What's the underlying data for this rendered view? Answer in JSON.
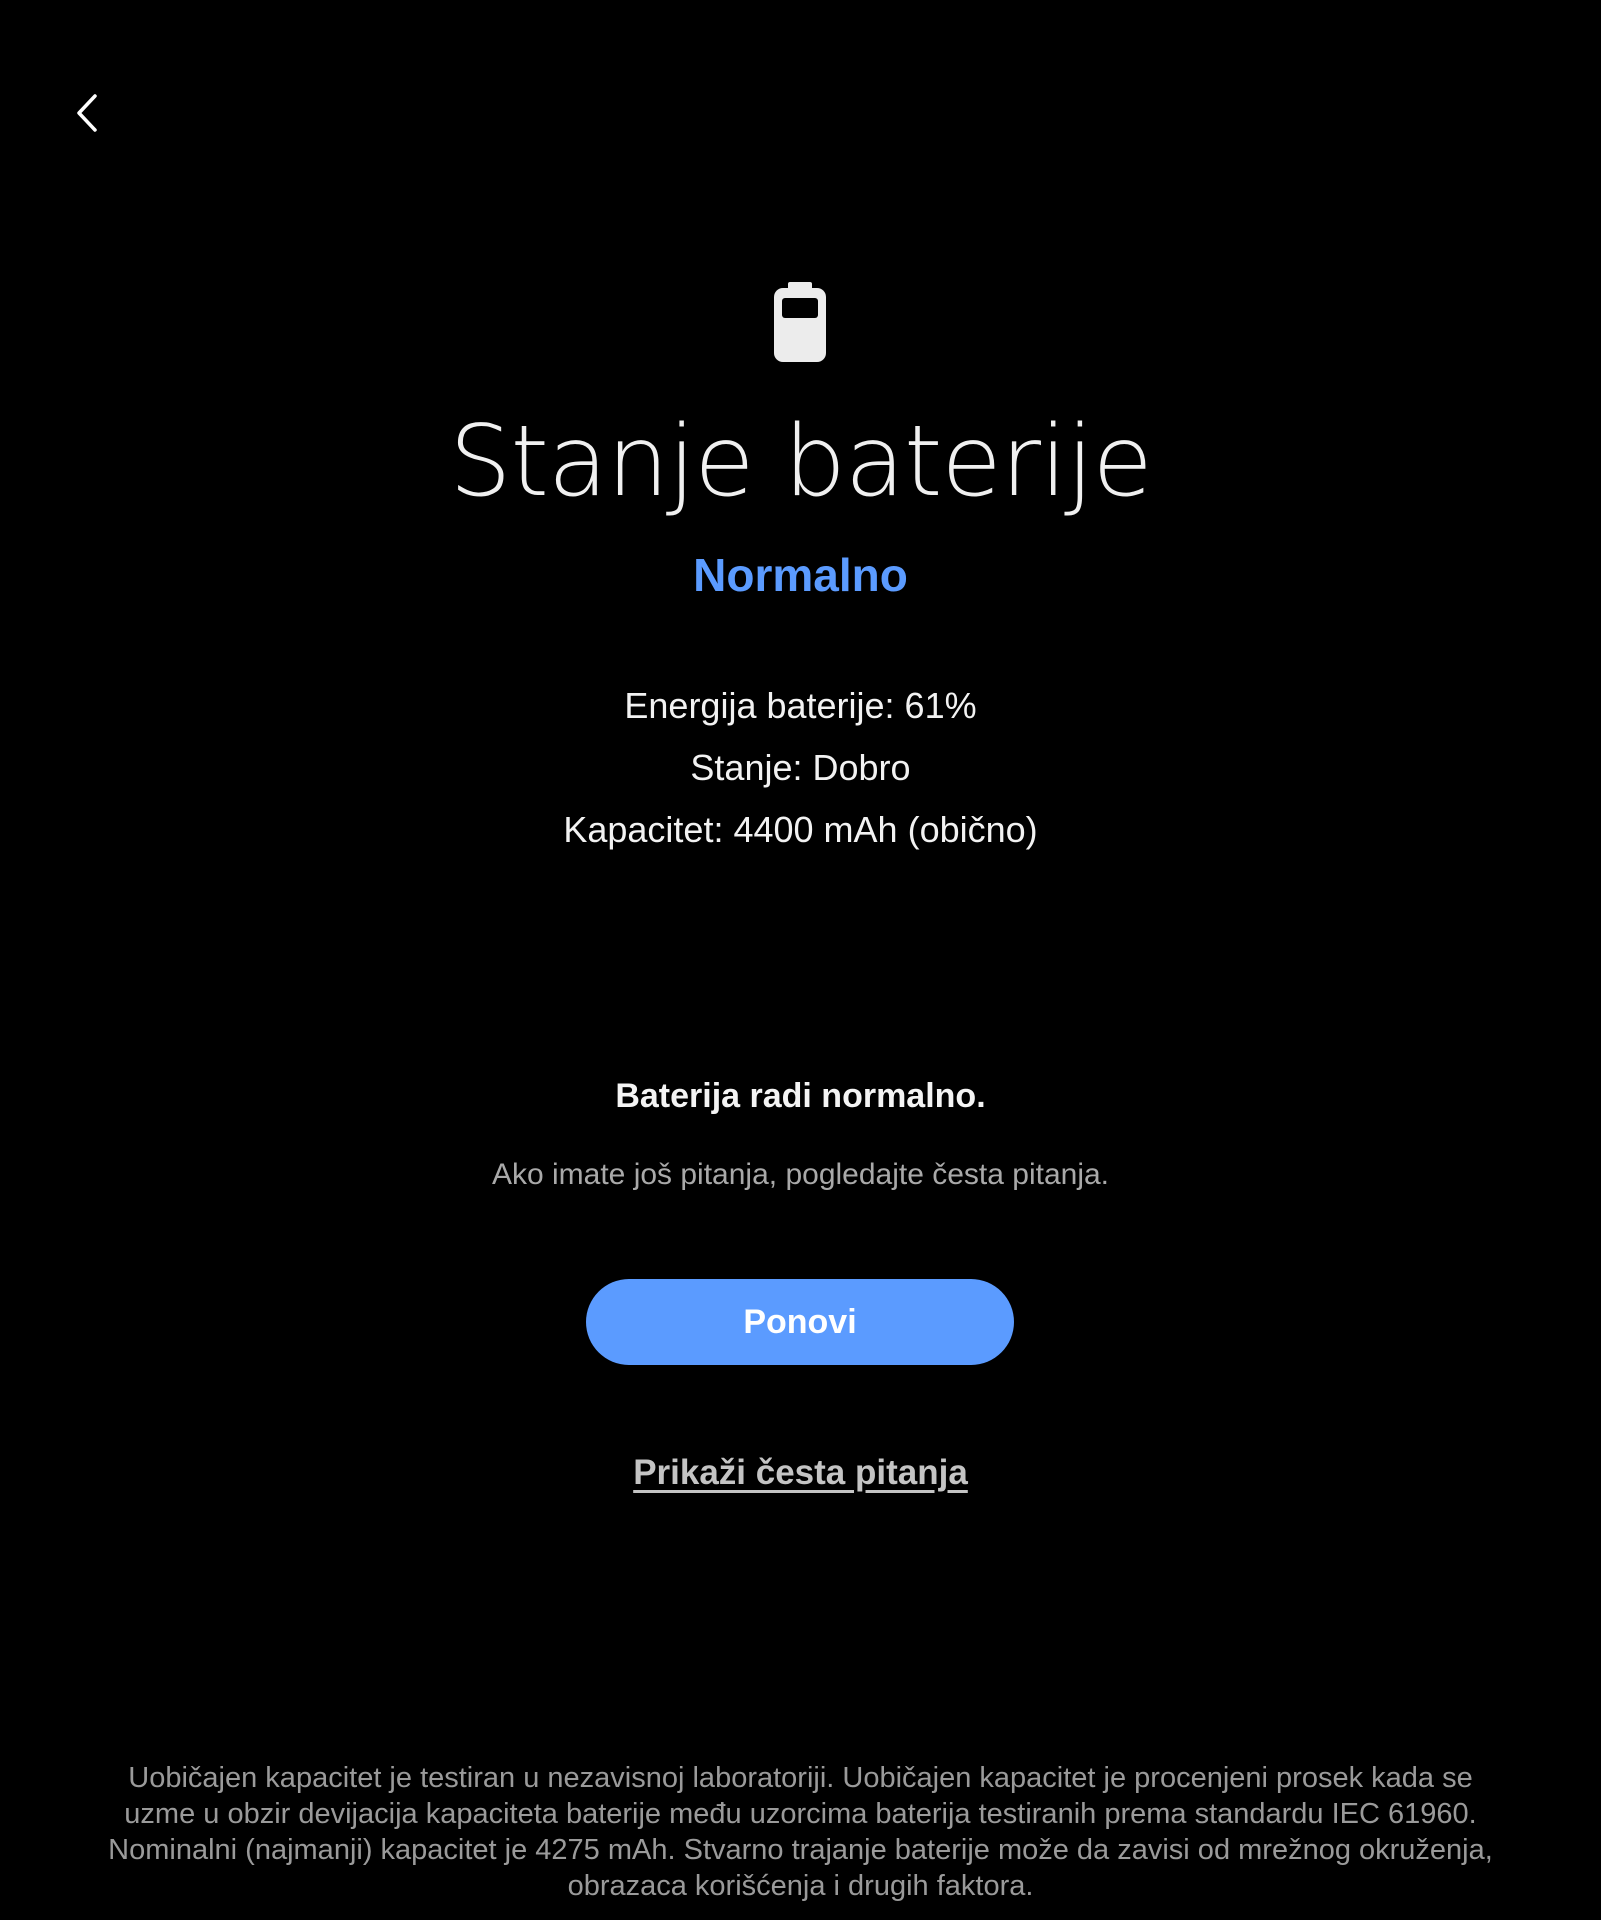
{
  "header": {
    "back_icon": "chevron-left-icon"
  },
  "hero": {
    "icon": "battery-icon",
    "title": "Stanje baterije",
    "status": "Normalno"
  },
  "details": {
    "items": [
      "Energija baterije: 61%",
      "Stanje: Dobro",
      "Kapacitet: 4400 mAh (obično)"
    ]
  },
  "result": {
    "message": "Baterija radi normalno.",
    "hint": "Ako imate još pitanja, pogledajte česta pitanja."
  },
  "actions": {
    "retry_label": "Ponovi",
    "faq_label": "Prikaži česta pitanja"
  },
  "footer": {
    "disclaimer": "Uobičajen kapacitet je testiran u nezavisnoj laboratoriji. Uobičajen kapacitet je procenjeni prosek kada se uzme u obzir devijacija kapaciteta baterije među uzorcima baterija testiranih prema standardu IEC 61960. Nominalni (najmanji) kapacitet je 4275 mAh. Stvarno trajanje baterije može da zavisi od mrežnog okruženja, obrazaca korišćenja i drugih faktora."
  },
  "colors": {
    "background": "#000000",
    "accent": "#5b9bff",
    "text_primary": "#f2f2f2",
    "text_secondary": "#a9a9a9"
  }
}
